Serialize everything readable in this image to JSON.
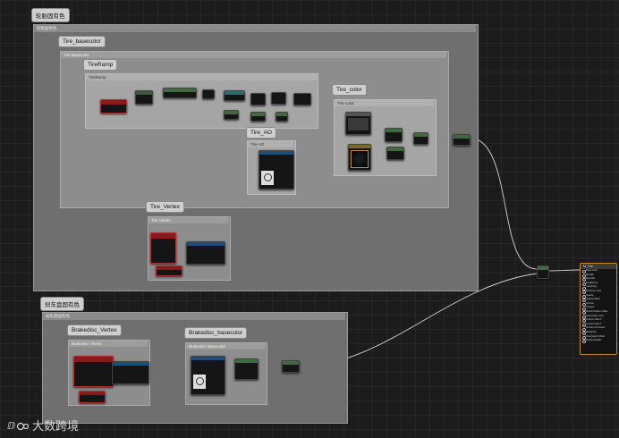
{
  "groups": {
    "tire_color_group": {
      "title": "轮胎固有色",
      "subtitle": "轮胎固有色"
    },
    "tire_basecolor": {
      "title": "Tire_basecolor",
      "subtitle": "Tire Basecolor"
    },
    "tire_ramp": {
      "title": "TireRamp",
      "subtitle": "TireRamp"
    },
    "tire_color": {
      "title": "Tire_color",
      "subtitle": "Tire color"
    },
    "tire_ao": {
      "title": "Tire_AO",
      "subtitle": "Tire AO"
    },
    "tire_vertex": {
      "title": "Tire_Vertex",
      "subtitle": "Tire Vertex"
    },
    "brake_group": {
      "title": "刹车盘固有色",
      "subtitle": "刹车盘固有色"
    },
    "brakedisc_vertex": {
      "title": "Brakedisc_Vertex",
      "subtitle": "Brakedisc Vertex"
    },
    "brakedisc_basecolor": {
      "title": "Brakedisc_basecolor",
      "subtitle": "Brakedisc Basecolor"
    }
  },
  "output_node": {
    "title": "M_Tire",
    "pins": [
      "Base Color",
      "Metallic",
      "Specular",
      "Roughness",
      "Anisotropy",
      "Emissive Color",
      "Opacity",
      "Opacity Mask",
      "Normal",
      "Tangent",
      "World Position Offset",
      "Subsurface Color",
      "Custom Data 0",
      "Custom Data 1",
      "Ambient Occlusion",
      "Refraction",
      "Pixel Depth Offset",
      "Shading Model"
    ]
  },
  "watermark": {
    "text": "大数跨境"
  },
  "colors": {
    "wire": "#e6e6e6",
    "output_border": "#c98a1c",
    "param_red": "#7a1414",
    "texture_blue": "#1e4e7a"
  }
}
